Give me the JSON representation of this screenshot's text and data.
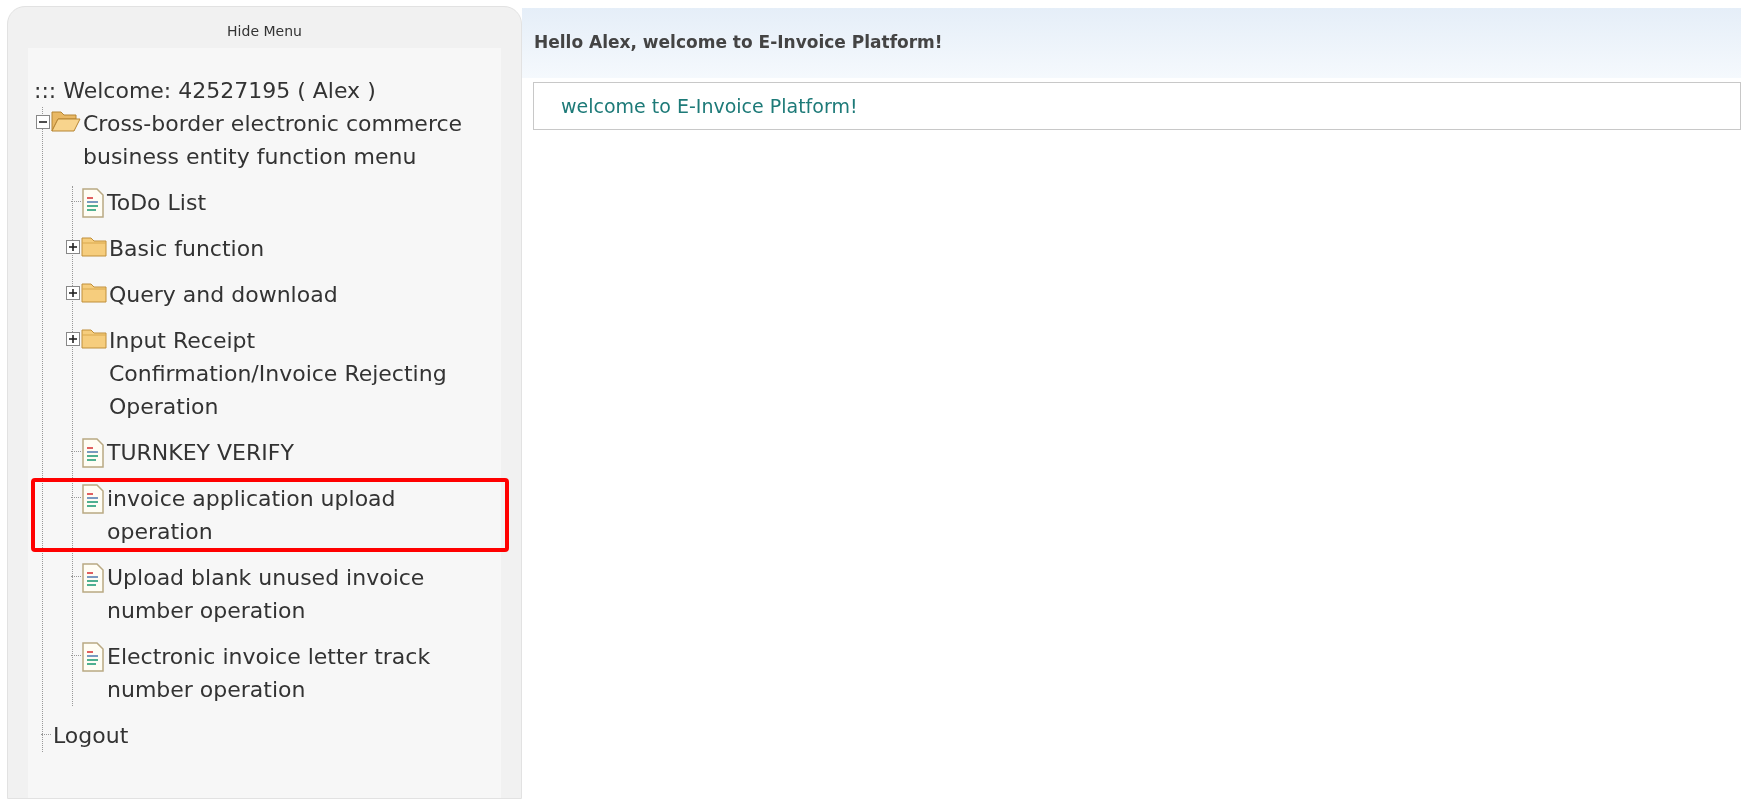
{
  "sidebar": {
    "hide_menu": "Hide Menu",
    "welcome": "::: Welcome: 42527195 ( Alex )",
    "tree": [
      {
        "kind": "folder",
        "label": "Cross-border electronic commerce business entity function menu",
        "expanded": true,
        "highlighted": false,
        "children": [
          {
            "kind": "page",
            "label": "ToDo List",
            "highlighted": false
          },
          {
            "kind": "folder",
            "label": "Basic function",
            "expanded": false,
            "highlighted": false
          },
          {
            "kind": "folder",
            "label": "Query and download",
            "expanded": false,
            "highlighted": false
          },
          {
            "kind": "folder",
            "label": "Input Receipt Confirmation/Invoice Rejecting Operation",
            "expanded": false,
            "highlighted": false
          },
          {
            "kind": "page",
            "label": "TURNKEY VERIFY",
            "highlighted": false
          },
          {
            "kind": "page",
            "label": "invoice application upload operation",
            "highlighted": true
          },
          {
            "kind": "page",
            "label": "Upload blank unused invoice number operation",
            "highlighted": false
          },
          {
            "kind": "page",
            "label": "Electronic invoice letter track number operation",
            "highlighted": false
          }
        ]
      },
      {
        "kind": "link",
        "label": "Logout",
        "highlighted": false
      }
    ]
  },
  "main": {
    "header": "Hello Alex, welcome to E-Invoice Platform!",
    "message": "welcome to E-Invoice Platform!"
  }
}
